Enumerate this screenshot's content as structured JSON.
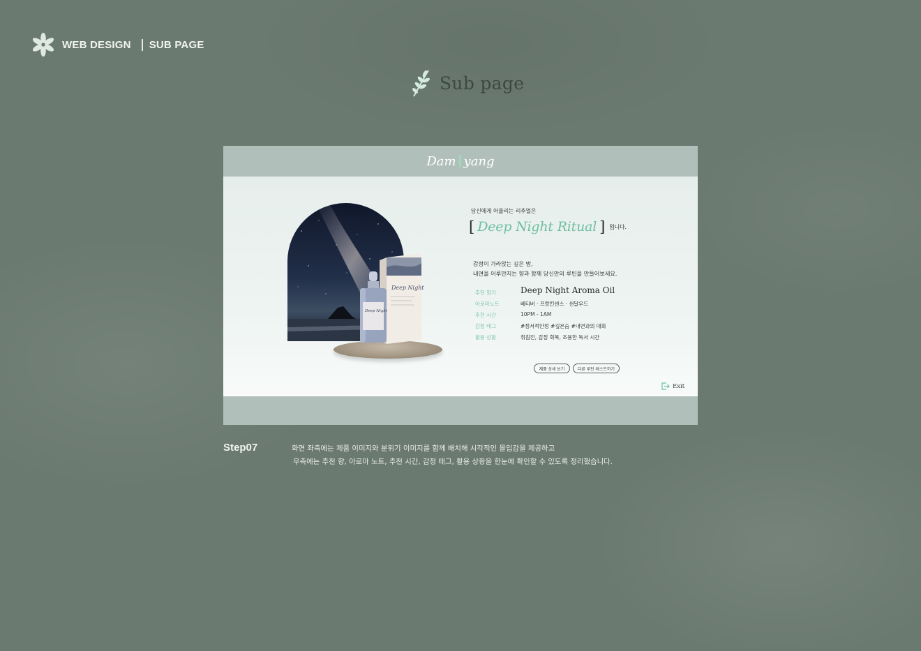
{
  "header": {
    "label_left": "WEB DESIGN",
    "label_right": "SUB PAGE"
  },
  "section": {
    "title": "Sub page"
  },
  "mockup": {
    "logo_left": "Dam",
    "logo_right": "yang",
    "intro": "당신에게 어울리는 리추얼은",
    "ritual_name": "Deep Night Ritual",
    "ritual_suffix": "입니다.",
    "desc_line1": "감정이 가라앉는 깊은 밤,",
    "desc_line2": "내면을 어루만지는 향과 함께 당신만의 루틴을 만들어보세요.",
    "product_label": "Deep Night",
    "info": [
      {
        "key": "추천 향기",
        "value": "Deep Night Aroma Oil"
      },
      {
        "key": "아로마노트",
        "value": "베티버 · 프랑킨센스 · 샌달우드"
      },
      {
        "key": "추천 시간",
        "value": "10PM - 1AM"
      },
      {
        "key": "감정 태그",
        "value": "#정서적안정 #깊은숨 #내면과의 대화"
      },
      {
        "key": "활용 상황",
        "value": "취침전, 감정 회복, 조용한 독서 시간"
      }
    ],
    "btn_detail": "제품 상세 보기",
    "btn_other": "다른 루틴 테스트하기",
    "exit": "Exit"
  },
  "step": {
    "label": "Step07",
    "line1": "화면 좌측에는 제품 이미지와 분위기 이미지를 함께 배치해 시각적인 몰입감을 제공하고",
    "line2": "우측에는 추천 향, 아로마 노트, 추천 시간, 감정 태그, 활용 상황을 한눈에 확인할 수 있도록 정리했습니다."
  },
  "colors": {
    "background": "#6b7a71",
    "accent": "#6fbfa1",
    "frame": "#b1bfba"
  },
  "icons": [
    "flower-logo-icon",
    "leaf-icon",
    "exit-icon"
  ]
}
